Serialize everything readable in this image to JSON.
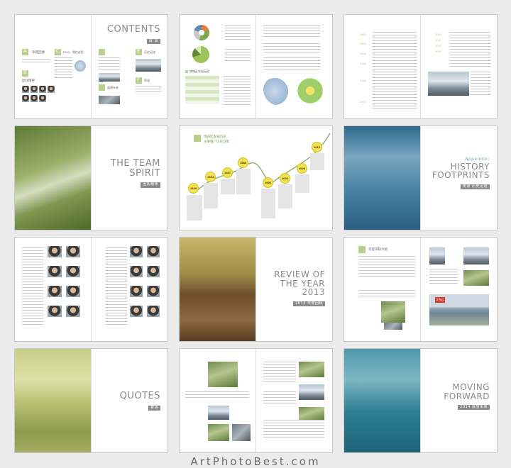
{
  "spreads": {
    "contents": {
      "title": "CONTENTS",
      "title_tag": "目  录",
      "letters": [
        "A",
        "B",
        "C",
        "D",
        "E",
        "F"
      ],
      "section_labels": [
        "年度回顾",
        "团队精神",
        "2013，我在这里",
        "历史足迹",
        "展望未来",
        "寄语"
      ]
    },
    "timeline_intro": {
      "heading": "增城区发展历史"
    },
    "history_text": {
      "years": [
        "2002",
        "2003",
        "2004",
        "2005",
        "2006",
        "2007",
        "2008",
        "2009",
        "2010",
        "2011",
        "2012",
        "2013"
      ]
    },
    "team_spirit": {
      "title_line1": "THE TEAM",
      "title_line2": "SPIRIT",
      "tag": "团队精神"
    },
    "timeline": {
      "heading_line1": "增城区发展历史",
      "heading_line2": "主要推广历史沿革",
      "years": [
        "1929",
        "1984",
        "1987",
        "1988",
        "1992",
        "2004",
        "2009",
        "2013"
      ]
    },
    "history": {
      "appendix": "Appendix:",
      "title_line1": "HISTORY",
      "title_line2": "FOOTPRINTS",
      "tag": "附录  历史足迹"
    },
    "review": {
      "title_line1": "REVIEW OF",
      "title_line2": "THE YEAR 2013",
      "tag": "2013 年度回顾"
    },
    "projects": {
      "heading": "年度项目介绍",
      "billboard": "大东山"
    },
    "quotes": {
      "title": "QUOTES",
      "tag": "寄语"
    },
    "moving": {
      "title_line1": "MOVING",
      "title_line2": "FORWARD",
      "tag": "2014 展望未来"
    }
  },
  "watermark": "ArtPhotoBest.com"
}
